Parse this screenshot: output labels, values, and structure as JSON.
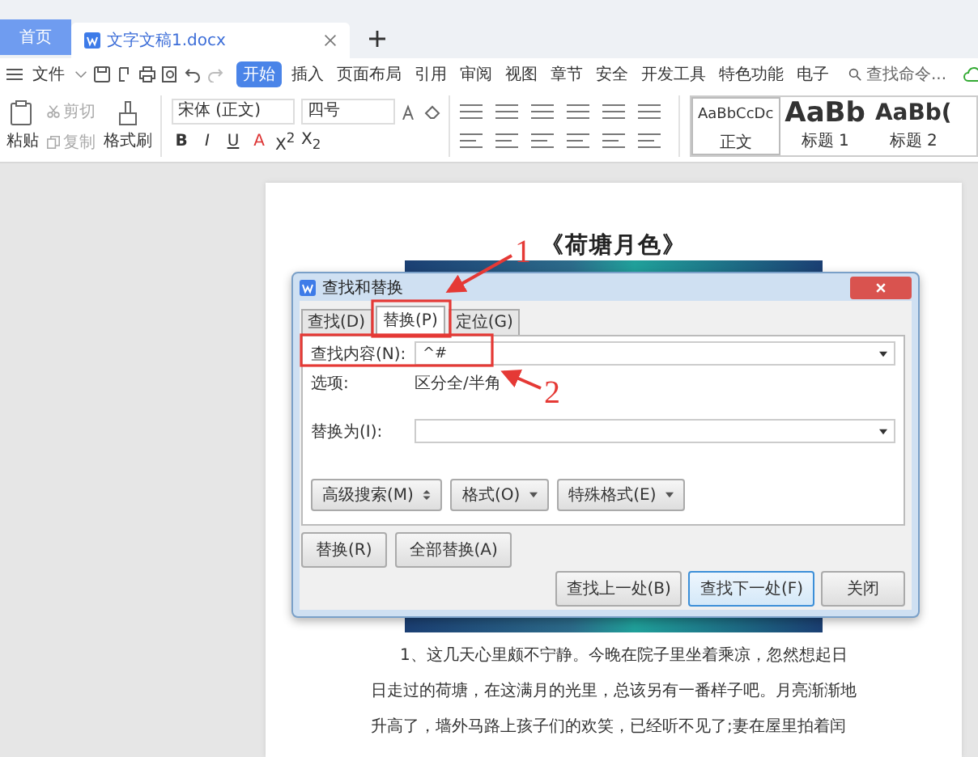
{
  "tabs": [
    {
      "label": "首页",
      "kind": "home",
      "selected": false
    },
    {
      "label": "文字文稿1.docx",
      "kind": "doc",
      "selected": true
    }
  ],
  "menu": {
    "file": "文件",
    "items": [
      {
        "label": "开始",
        "selected": true
      },
      {
        "label": "插入",
        "selected": false
      },
      {
        "label": "页面布局",
        "selected": false
      },
      {
        "label": "引用",
        "selected": false
      },
      {
        "label": "审阅",
        "selected": false
      },
      {
        "label": "视图",
        "selected": false
      },
      {
        "label": "章节",
        "selected": false
      },
      {
        "label": "安全",
        "selected": false
      },
      {
        "label": "开发工具",
        "selected": false
      },
      {
        "label": "特色功能",
        "selected": false
      },
      {
        "label": "电子",
        "selected": false
      }
    ],
    "search_placeholder": "查找命令..."
  },
  "ribbon": {
    "paste": "粘贴",
    "cut": "剪切",
    "copy": "复制",
    "format_painter": "格式刷",
    "font": "宋体 (正文)",
    "size": "四号",
    "format_buttons": [
      "B",
      "I",
      "U",
      "A",
      "X$^{2}$",
      "X$_{2}$"
    ],
    "styles": [
      {
        "sample": "AaBbCcDc",
        "name": "正文",
        "kind": "normal"
      },
      {
        "sample": "AaBb",
        "name": "标题 1",
        "kind": "h1"
      },
      {
        "sample": "AaBb(",
        "name": "标题 2",
        "kind": "h2"
      }
    ]
  },
  "document": {
    "title": "《荷塘月色》",
    "lines": [
      "1、这几天心里颇不宁静。今晚在院子里坐着乘凉，忽然想起日",
      "日走过的荷塘，在这满月的光里，总该另有一番样子吧。月亮渐渐地",
      "升高了，墙外马路上孩子们的欢笑，已经听不见了;妻在屋里拍着闰"
    ]
  },
  "dialog": {
    "title": "查找和替换",
    "tabs": [
      {
        "label": "查找(D)",
        "selected": false
      },
      {
        "label": "替换(P)",
        "selected": true
      },
      {
        "label": "定位(G)",
        "selected": false
      }
    ],
    "find_label": "查找内容(N):",
    "find_value": "^#",
    "options_label": "选项:",
    "options_value": "区分全/半角",
    "replace_label": "替换为(I):",
    "option_buttons": [
      "高级搜索(M)",
      "格式(O)",
      "特殊格式(E)"
    ],
    "replace_buttons": [
      "替换(R)",
      "全部替换(A)"
    ],
    "nav_buttons": [
      {
        "label": "查找上一处(B)",
        "selected": false
      },
      {
        "label": "查找下一处(F)",
        "selected": true
      },
      {
        "label": "关闭",
        "selected": false
      }
    ]
  },
  "annotations": [
    {
      "number": "1"
    },
    {
      "number": "2"
    }
  ]
}
